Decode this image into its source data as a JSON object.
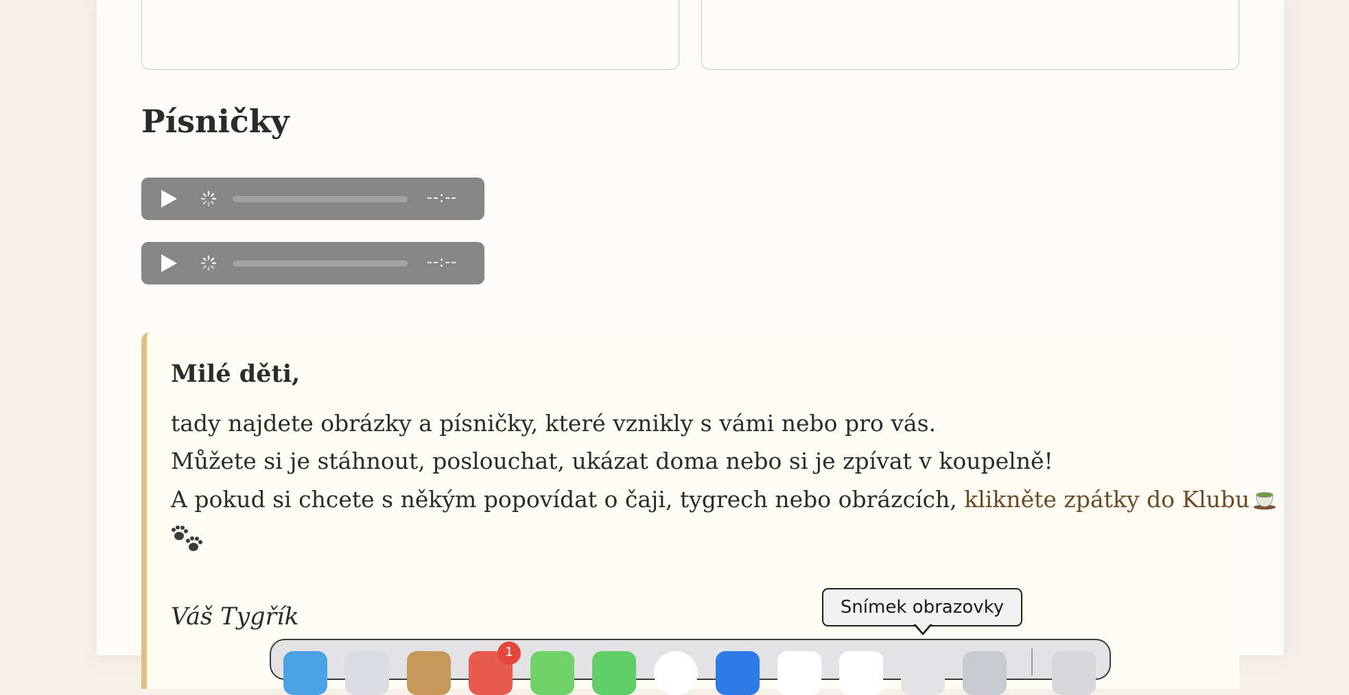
{
  "gallery": {
    "frames": [
      "left-image-frame",
      "right-image-frame"
    ]
  },
  "songs": {
    "title": "Písničky",
    "players": [
      {
        "time_label": "--:--"
      },
      {
        "time_label": "--:--"
      }
    ]
  },
  "letter": {
    "greeting": "Milé děti,",
    "line1": "tady najdete obrázky a písničky, které vznikly s vámi nebo pro vás.",
    "line2": "Můžete si je stáhnout, poslouchat, ukázat doma nebo si je zpívat v koupelně!",
    "line3_prefix": "A pokud si chcete s někým popovídat o čaji, tygrech nebo obrázcích, ",
    "club_link": "klikněte zpátky do Klubu",
    "signature": "Váš Tygřík",
    "link_color": "#6b4a26",
    "accent_color": "#dcc27e"
  },
  "tooltip": {
    "text": "Snímek obrazovky"
  },
  "dock": {
    "badge": "1"
  }
}
